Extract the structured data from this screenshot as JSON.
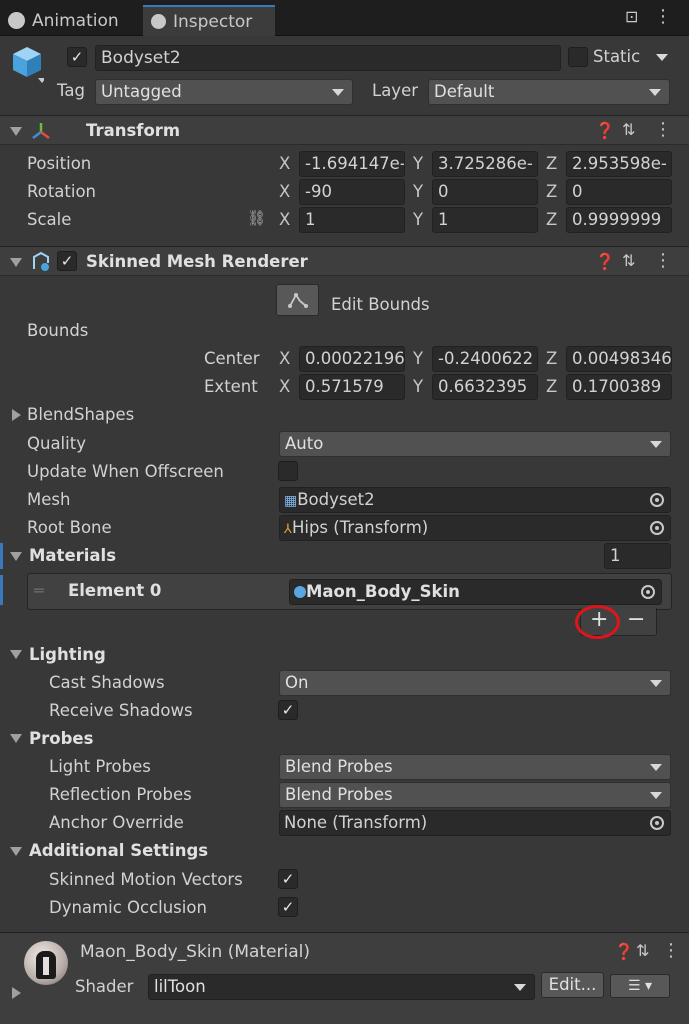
{
  "tabs": {
    "animation": "Animation",
    "inspector": "Inspector"
  },
  "object": {
    "name": "Bodyset2",
    "static_label": "Static",
    "tag_label": "Tag",
    "tag_value": "Untagged",
    "layer_label": "Layer",
    "layer_value": "Default",
    "active": true
  },
  "transform": {
    "title": "Transform",
    "position_label": "Position",
    "rotation_label": "Rotation",
    "scale_label": "Scale",
    "x": "X",
    "y": "Y",
    "z": "Z",
    "position": [
      "-1.694147e-",
      "3.725286e-",
      "2.953598e-"
    ],
    "rotation": [
      "-90",
      "0",
      "0"
    ],
    "scale": [
      "1",
      "1",
      "0.9999999"
    ]
  },
  "smr": {
    "title": "Skinned Mesh Renderer",
    "edit_bounds": "Edit Bounds",
    "bounds_label": "Bounds",
    "center_label": "Center",
    "extent_label": "Extent",
    "center": [
      "0.00022196",
      "-0.2400622",
      "0.00498346"
    ],
    "extent": [
      "0.571579",
      "0.6632395",
      "0.1700389"
    ],
    "blendshapes": "BlendShapes",
    "quality_label": "Quality",
    "quality_value": "Auto",
    "update_offscreen_label": "Update When Offscreen",
    "mesh_label": "Mesh",
    "mesh_value": "Bodyset2",
    "rootbone_label": "Root Bone",
    "rootbone_value": "Hips (Transform)",
    "materials_label": "Materials",
    "materials_count": "1",
    "element_label": "Element 0",
    "element_value": "Maon_Body_Skin",
    "add": "+",
    "remove": "−",
    "lighting_label": "Lighting",
    "cast_shadows_label": "Cast Shadows",
    "cast_shadows_value": "On",
    "receive_shadows_label": "Receive Shadows",
    "probes_label": "Probes",
    "light_probes_label": "Light Probes",
    "light_probes_value": "Blend Probes",
    "reflection_probes_label": "Reflection Probes",
    "reflection_probes_value": "Blend Probes",
    "anchor_label": "Anchor Override",
    "anchor_value": "None (Transform)",
    "additional_label": "Additional Settings",
    "motion_vectors_label": "Skinned Motion Vectors",
    "dynamic_occlusion_label": "Dynamic Occlusion"
  },
  "material": {
    "title": "Maon_Body_Skin (Material)",
    "shader_label": "Shader",
    "shader_value": "lilToon",
    "edit_button": "Edit..."
  },
  "icons": {
    "checkmark": "✓",
    "help": "?",
    "preset": "⇄",
    "menu": "⋮",
    "lock": "🔒"
  },
  "colors": {
    "accent": "#3a79bb",
    "highlight_circle": "#e0151b"
  }
}
